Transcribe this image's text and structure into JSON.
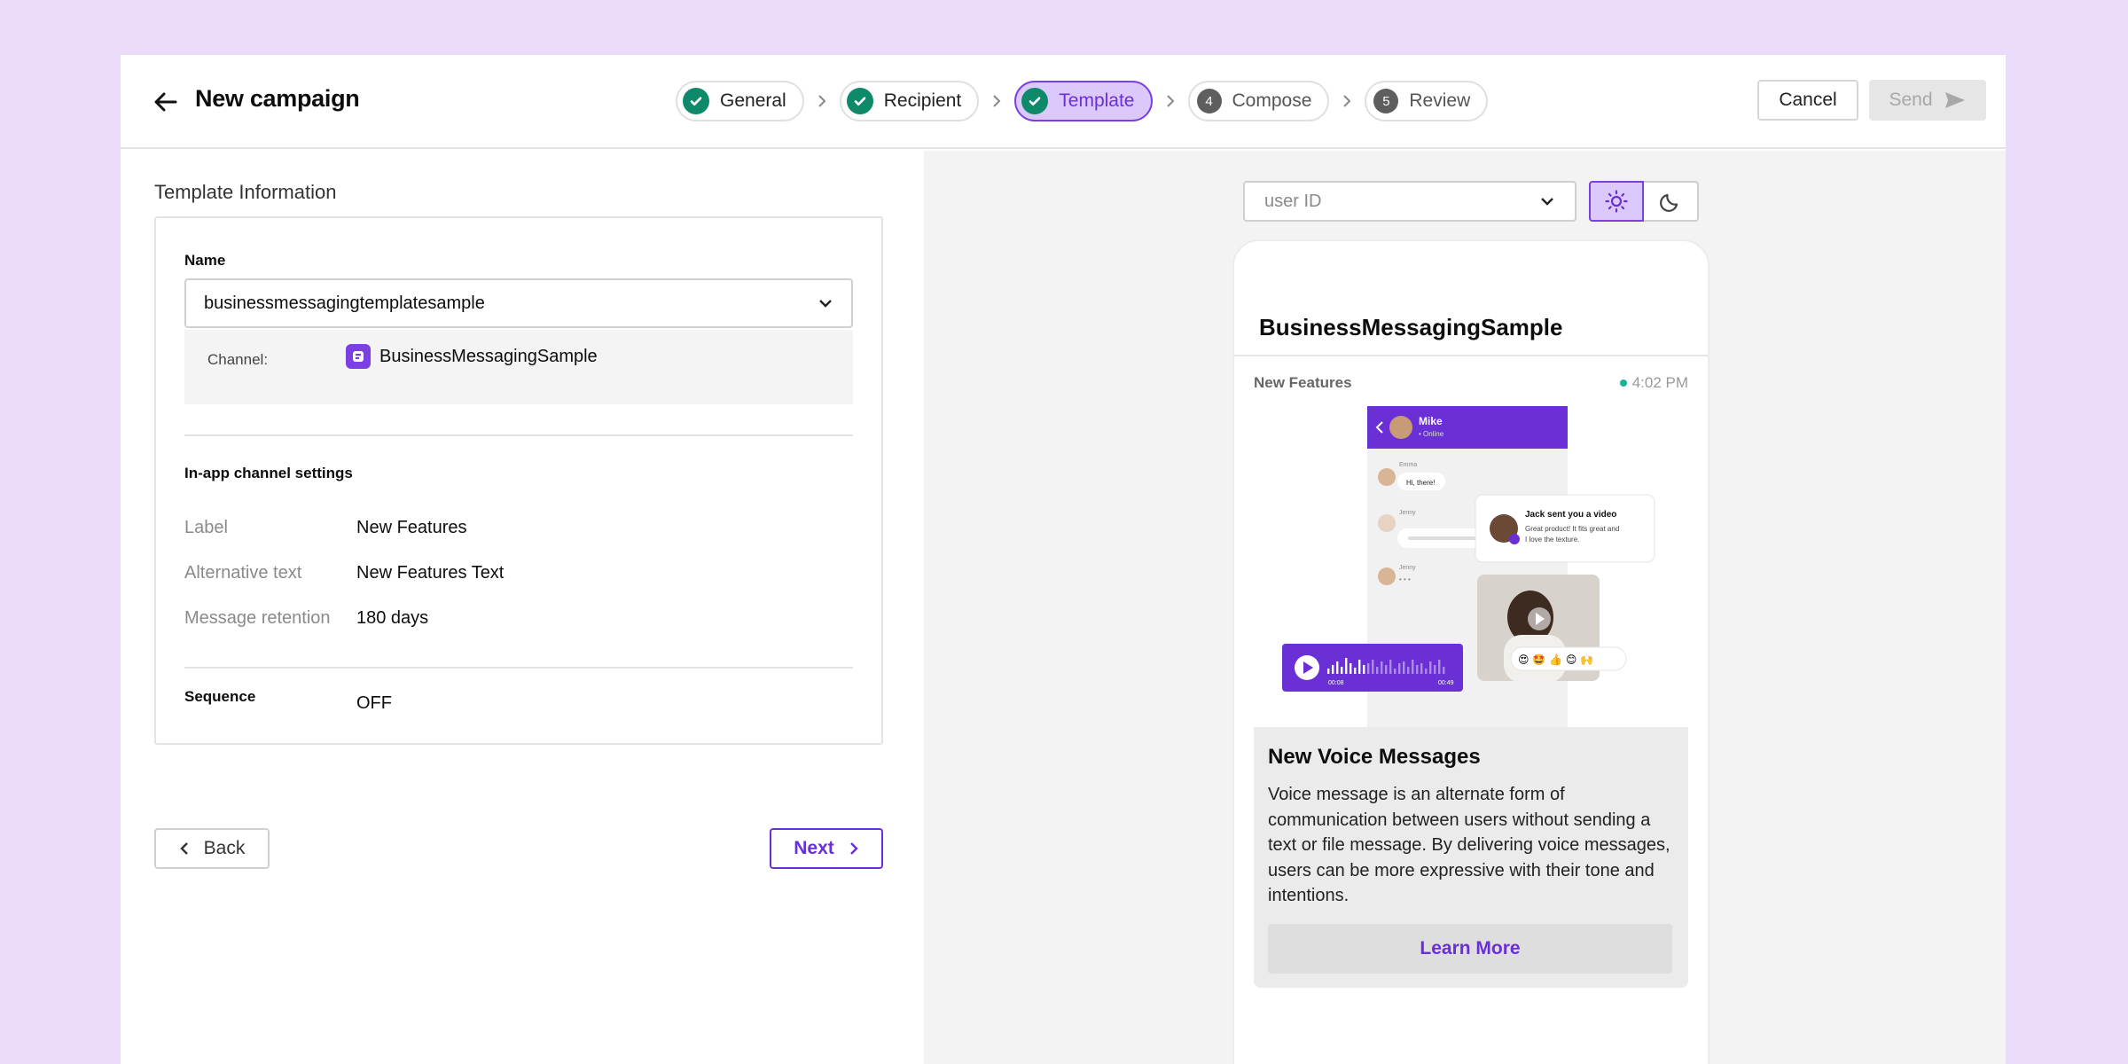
{
  "header": {
    "title": "New campaign",
    "steps": [
      {
        "label": "General",
        "status": "done"
      },
      {
        "label": "Recipient",
        "status": "done"
      },
      {
        "label": "Template",
        "status": "active"
      },
      {
        "label": "Compose",
        "number": "4",
        "status": "pending"
      },
      {
        "label": "Review",
        "number": "5",
        "status": "pending"
      }
    ],
    "cancel_label": "Cancel",
    "send_label": "Send"
  },
  "template_info": {
    "heading": "Template Information",
    "name_label": "Name",
    "name_value": "businessmessagingtemplatesample",
    "channel_label": "Channel:",
    "channel_value": "BusinessMessagingSample",
    "settings_heading": "In-app channel settings",
    "settings": [
      {
        "key": "Label",
        "value": "New Features"
      },
      {
        "key": "Alternative text",
        "value": "New Features Text"
      },
      {
        "key": "Message retention",
        "value": "180 days"
      }
    ],
    "sequence_label": "Sequence",
    "sequence_value": "OFF"
  },
  "nav": {
    "back_label": "Back",
    "next_label": "Next"
  },
  "preview": {
    "user_select_placeholder": "user ID",
    "phone_title": "BusinessMessagingSample",
    "message_label": "New Features",
    "message_time": "4:02 PM",
    "image": {
      "chat_name": "Mike",
      "chat_status": "• Online",
      "sender1": "Emma",
      "bubble1": "Hi, there!",
      "sender2": "Jenny",
      "sender3": "Jenny",
      "typing": "• • •",
      "notification_title": "Jack sent you a video",
      "notification_line1": "Great product! It fits great and",
      "notification_line2": "I love the texture.",
      "audio_elapsed": "00:08",
      "audio_total": "00:49",
      "emojis": "😍 🤩 👍 😊 🙌"
    },
    "headline": "New Voice Messages",
    "body": "Voice message is an alternate form of communication between users without sending a text or file message. By delivering voice messages, users can be more expressive with their tone and intentions.",
    "button_label": "Learn More"
  },
  "colors": {
    "accent": "#6a2fd6",
    "accent_light": "#dcc9fb",
    "success": "#0e8a6b",
    "page_bg": "#ecdcfb"
  }
}
